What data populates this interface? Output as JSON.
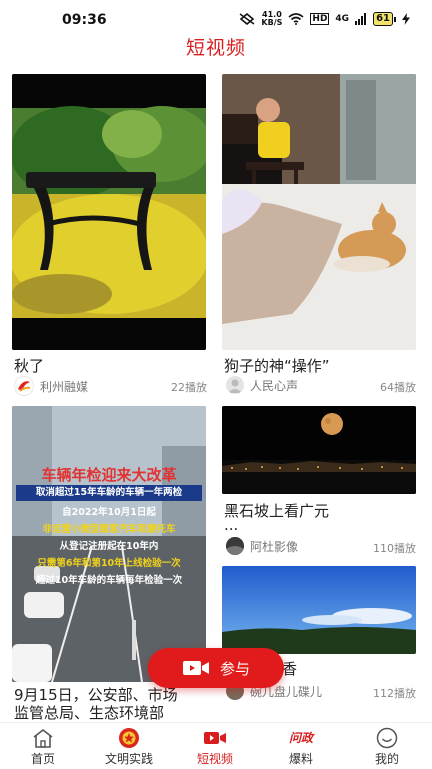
{
  "status": {
    "time": "09:36",
    "net_speed": "41.0",
    "net_unit": "KB/S",
    "hd": "HD",
    "signal": "4G",
    "battery": "61"
  },
  "header": {
    "title": "短视频"
  },
  "videos": [
    {
      "title": "秋了",
      "source": "利州融媒",
      "plays": "22播放"
    },
    {
      "title": "狗子的神“操作”",
      "source": "人民心声",
      "plays": "64播放"
    },
    {
      "title": "黑石坡上看广元",
      "title_line2": "...",
      "source": "阿杜影像",
      "plays": "110播放"
    },
    {
      "title_line1": "9月15日，公安部、市场",
      "title_line2": "监管总局、生态环境部",
      "banner_title": "车辆年检迎来大改革",
      "banner_sub": "取消超过15年车龄的车辆一年两检",
      "lines": [
        "自2022年10月1日起",
        "非运营小微型载客汽车和摩托车",
        "从登记注册起在10年内",
        "只需第6年和第10年上线检验一次",
        "超过10年车龄的车辆每年检验一次"
      ]
    },
    {
      "title_partial": "香",
      "source": "碗儿盘儿碟儿",
      "plays": "112播放"
    }
  ],
  "fab": {
    "label": "参与"
  },
  "tabs": [
    {
      "label": "首页"
    },
    {
      "label": "文明实践"
    },
    {
      "label": "短视频"
    },
    {
      "label": "爆料",
      "icon_text": "问政"
    },
    {
      "label": "我的"
    }
  ],
  "colors": {
    "brand_red": "#d81e1e"
  }
}
